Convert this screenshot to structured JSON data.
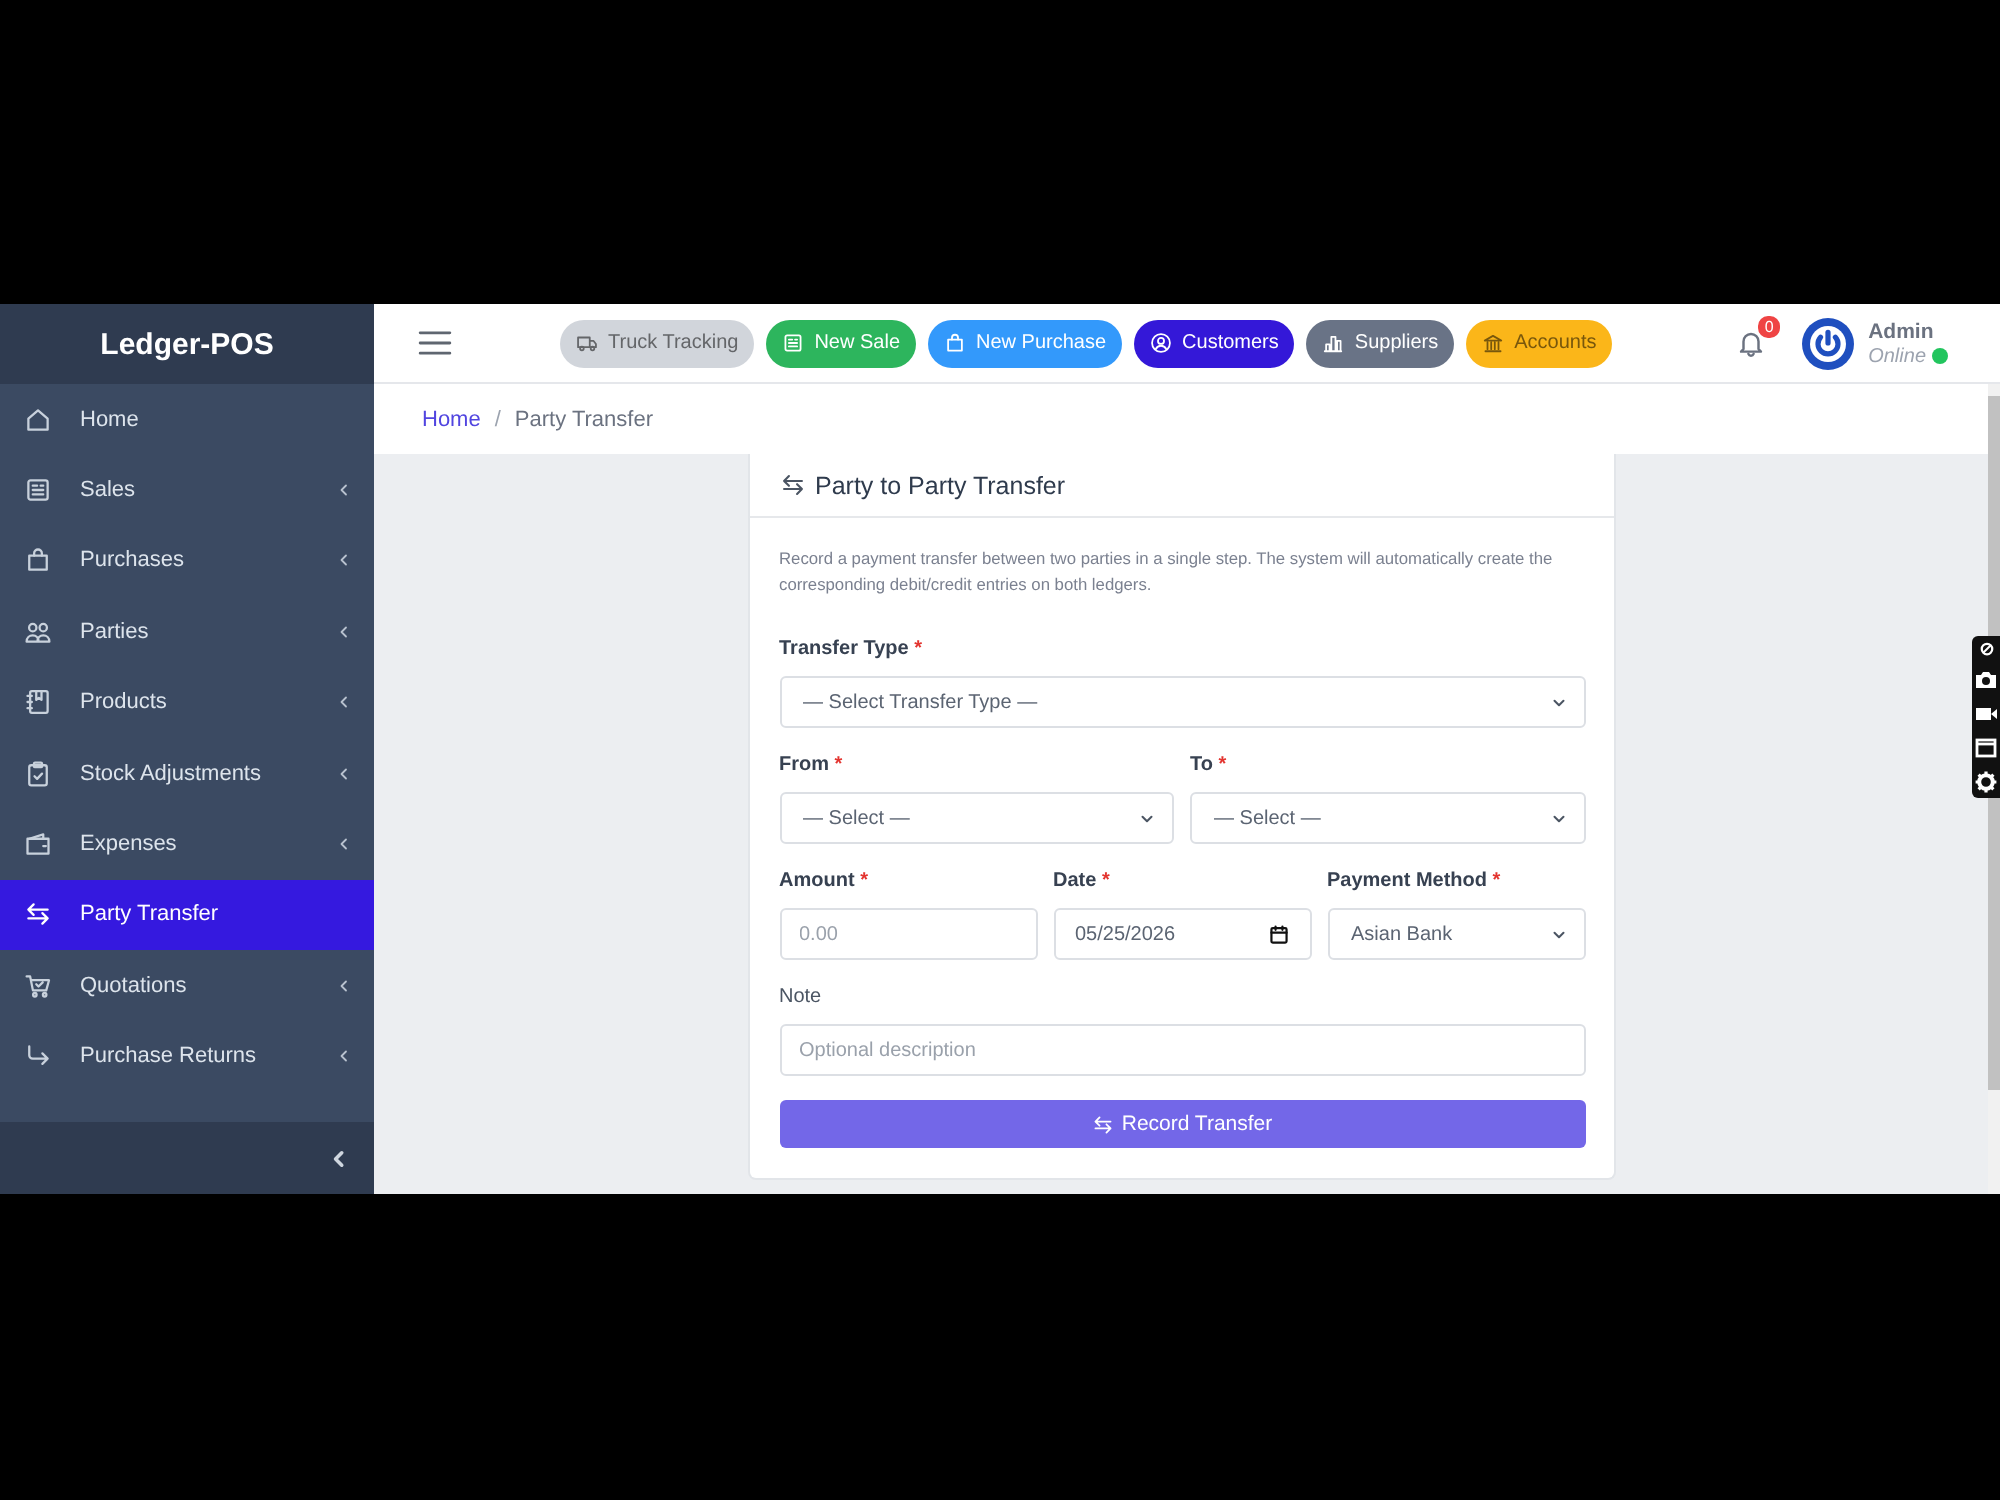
{
  "sidebar": {
    "brand": "Ledger-POS",
    "items": [
      {
        "label": "Home",
        "submenu": false,
        "selected": false
      },
      {
        "label": "Sales",
        "submenu": true,
        "selected": false
      },
      {
        "label": "Purchases",
        "submenu": true,
        "selected": false
      },
      {
        "label": "Parties",
        "submenu": true,
        "selected": false
      },
      {
        "label": "Products",
        "submenu": true,
        "selected": false
      },
      {
        "label": "Stock Adjustments",
        "submenu": true,
        "selected": false
      },
      {
        "label": "Expenses",
        "submenu": true,
        "selected": false
      },
      {
        "label": "Party Transfer",
        "submenu": false,
        "selected": true
      },
      {
        "label": "Quotations",
        "submenu": true,
        "selected": false
      },
      {
        "label": "Purchase Returns",
        "submenu": true,
        "selected": false
      }
    ]
  },
  "topbar": {
    "quick_actions": [
      {
        "label": "Truck Tracking",
        "color": "#d1d5db"
      },
      {
        "label": "New Sale",
        "color": "#2db55d"
      },
      {
        "label": "New Purchase",
        "color": "#3399fb"
      },
      {
        "label": "Customers",
        "color": "#3418d8"
      },
      {
        "label": "Suppliers",
        "color": "#697386"
      },
      {
        "label": "Accounts",
        "color": "#fbb619"
      }
    ],
    "notifications": {
      "count": "0"
    },
    "user": {
      "name": "Admin",
      "status": "Online",
      "online": true
    }
  },
  "breadcrumb": {
    "separator": "/",
    "items": [
      {
        "label": "Home",
        "current": false
      },
      {
        "label": "Party Transfer",
        "current": true
      }
    ]
  },
  "card": {
    "title": "Party to Party Transfer",
    "description": "Record a payment transfer between two parties in a single step. The system will automatically create the corresponding debit/credit entries on both ledgers.",
    "rows": [
      {
        "fields": [
          {
            "kind": "select",
            "label": "Transfer Type",
            "required_mark": "*",
            "value": "— Select Transfer Type —"
          }
        ]
      },
      {
        "fields": [
          {
            "kind": "select",
            "label": "From",
            "required_mark": "*",
            "value": "— Select —"
          },
          {
            "kind": "select",
            "label": "To",
            "required_mark": "*",
            "value": "— Select —"
          }
        ]
      },
      {
        "fields": [
          {
            "kind": "text",
            "label": "Amount",
            "required_mark": "*",
            "placeholder": "0.00"
          },
          {
            "kind": "date",
            "label": "Date",
            "required_mark": "*",
            "value": "05/25/2026"
          },
          {
            "kind": "select",
            "label": "Payment Method",
            "required_mark": "*",
            "value": "Asian Bank"
          }
        ]
      },
      {
        "fields": [
          {
            "kind": "text",
            "label": "Note",
            "placeholder": "Optional description"
          }
        ]
      }
    ],
    "submit": {
      "label": "Record Transfer"
    }
  }
}
